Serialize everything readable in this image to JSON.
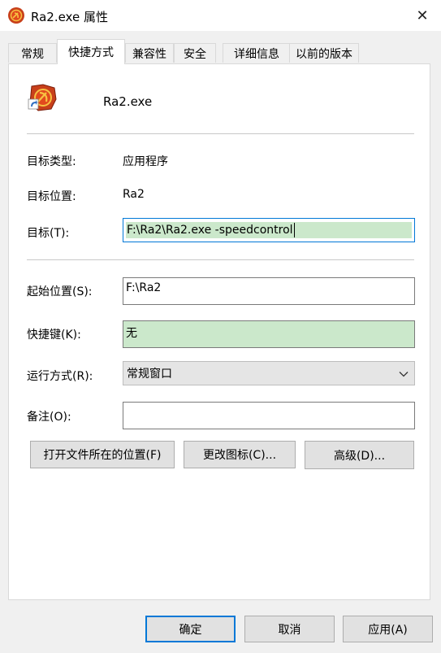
{
  "window": {
    "title": "Ra2.exe 属性",
    "close_symbol": "✕"
  },
  "tabs": [
    {
      "label": "常规"
    },
    {
      "label": "快捷方式"
    },
    {
      "label": "兼容性"
    },
    {
      "label": "安全"
    },
    {
      "label": "详细信息"
    },
    {
      "label": "以前的版本"
    }
  ],
  "active_tab": "快捷方式",
  "shortcut": {
    "file_name": "Ra2.exe",
    "target_type_label": "目标类型:",
    "target_type_value": "应用程序",
    "target_location_label": "目标位置:",
    "target_location_value": "Ra2",
    "target_label": "目标(T):",
    "target_value": "F:\\Ra2\\Ra2.exe -speedcontrol",
    "start_in_label": "起始位置(S):",
    "start_in_value": "F:\\Ra2",
    "hotkey_label": "快捷键(K):",
    "hotkey_value": "无",
    "run_label": "运行方式(R):",
    "run_value": "常规窗口",
    "comment_label": "备注(O):",
    "comment_value": ""
  },
  "actions": {
    "open_location": "打开文件所在的位置(F)",
    "change_icon": "更改图标(C)...",
    "advanced": "高级(D)..."
  },
  "footer": {
    "ok": "确定",
    "cancel": "取消",
    "apply": "应用(A)"
  },
  "colors": {
    "accent": "#0078d7",
    "selection": "#cbe8cb",
    "panel": "#ffffff",
    "window_bg": "#f0f0f0"
  },
  "icons": {
    "app": "red-alert-hammer-sickle-icon",
    "shortcut_arrow": "shortcut-arrow-icon"
  }
}
